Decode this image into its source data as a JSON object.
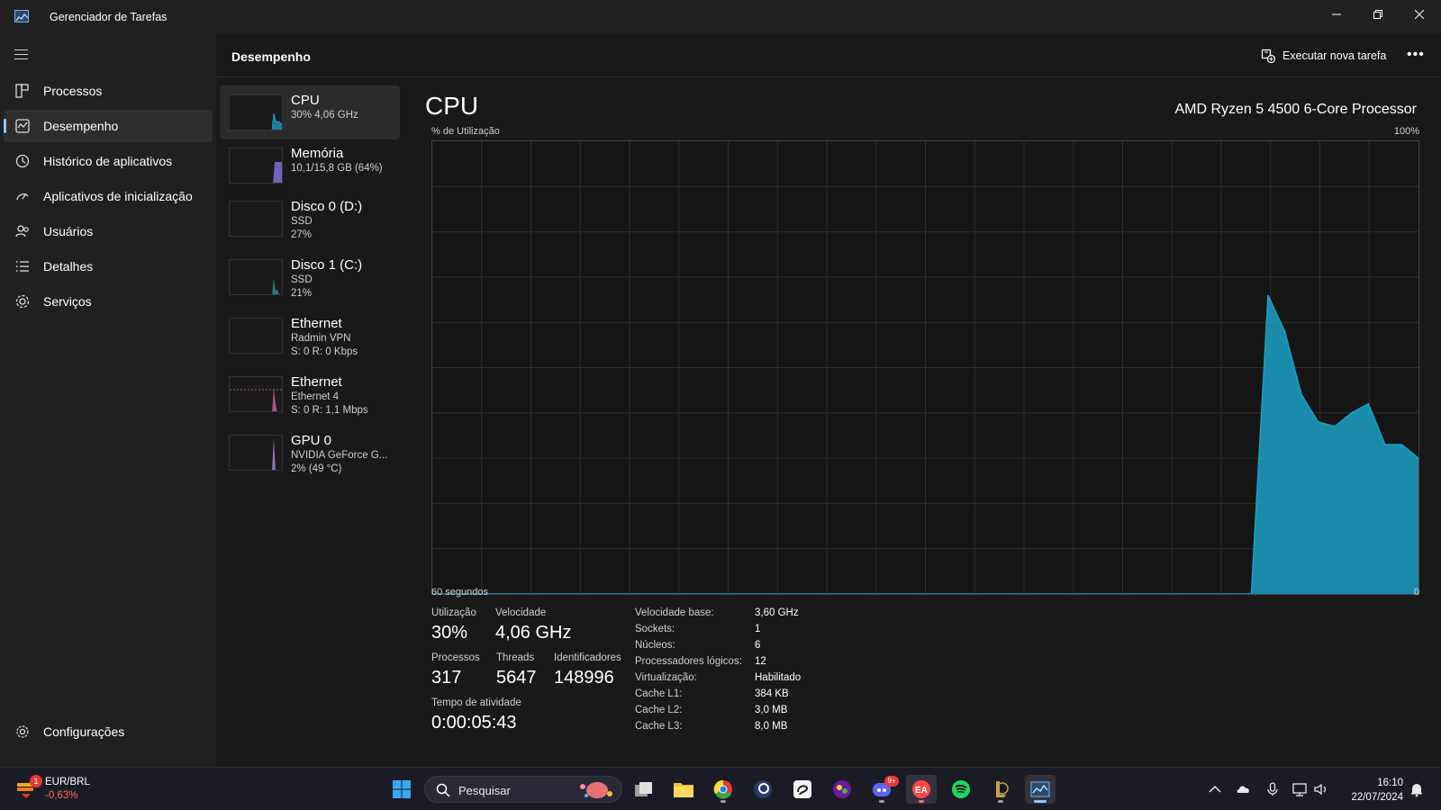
{
  "window": {
    "title": "Gerenciador de Tarefas",
    "minimize_icon": "minimize-icon",
    "restore_icon": "restore-icon",
    "close_icon": "close-icon"
  },
  "sidebar": {
    "items": [
      {
        "label": "Processos",
        "icon": "processes-icon"
      },
      {
        "label": "Desempenho",
        "icon": "performance-icon",
        "active": true
      },
      {
        "label": "Histórico de aplicativos",
        "icon": "history-icon"
      },
      {
        "label": "Aplicativos de inicialização",
        "icon": "startup-icon"
      },
      {
        "label": "Usuários",
        "icon": "users-icon"
      },
      {
        "label": "Detalhes",
        "icon": "details-icon"
      },
      {
        "label": "Serviços",
        "icon": "services-icon"
      }
    ],
    "settings_label": "Configurações"
  },
  "header": {
    "title": "Desempenho",
    "run_task_label": "Executar nova tarefa",
    "more_label": "•••"
  },
  "resources": [
    {
      "name": "CPU",
      "line1": "30% 4,06 GHz",
      "line2": "",
      "color": "#17a5c7"
    },
    {
      "name": "Memória",
      "line1": "10,1/15,8 GB (64%)",
      "line2": "",
      "color": "#8e7cf0"
    },
    {
      "name": "Disco 0 (D:)",
      "line1": "SSD",
      "line2": "27%",
      "color": "#2aa198"
    },
    {
      "name": "Disco 1 (C:)",
      "line1": "SSD",
      "line2": "21%",
      "color": "#2aa198"
    },
    {
      "name": "Ethernet",
      "line1": "Radmin VPN",
      "line2": "S: 0 R: 0 Kbps",
      "color": "#d45fa0"
    },
    {
      "name": "Ethernet",
      "line1": "Ethernet 4",
      "line2": "S: 0 R: 1,1 Mbps",
      "color": "#d45fa0"
    },
    {
      "name": "GPU 0",
      "line1": "NVIDIA GeForce G...",
      "line2": "2% (49 °C)",
      "color": "#a97de0"
    }
  ],
  "detail": {
    "title": "CPU",
    "model": "AMD Ryzen 5 4500 6-Core Processor",
    "y_label": "% de Utilização",
    "y_max": "100%",
    "x_label": "60 segundos",
    "y_min": "0",
    "fill_color": "#1ba0c4",
    "series": [
      0,
      0,
      0,
      0,
      0,
      0,
      0,
      0,
      0,
      0,
      0,
      0,
      0,
      0,
      0,
      0,
      0,
      0,
      0,
      0,
      0,
      0,
      0,
      0,
      0,
      0,
      0,
      0,
      0,
      0,
      0,
      0,
      0,
      0,
      0,
      0,
      0,
      0,
      0,
      0,
      0,
      0,
      0,
      0,
      0,
      0,
      0,
      0,
      0,
      0,
      66,
      58,
      44,
      38,
      37,
      40,
      42,
      33,
      33,
      30
    ],
    "stats": {
      "util_label": "Utilização",
      "util_value": "30%",
      "speed_label": "Velocidade",
      "speed_value": "4,06 GHz",
      "proc_label": "Processos",
      "proc_value": "317",
      "threads_label": "Threads",
      "threads_value": "5647",
      "handles_label": "Identificadores",
      "handles_value": "148996",
      "uptime_label": "Tempo de atividade",
      "uptime_value": "0:00:05:43"
    },
    "specs": [
      {
        "label": "Velocidade base:",
        "value": "3,60 GHz"
      },
      {
        "label": "Sockets:",
        "value": "1"
      },
      {
        "label": "Núcleos:",
        "value": "6"
      },
      {
        "label": "Processadores lógicos:",
        "value": "12"
      },
      {
        "label": "Virtualização:",
        "value": "Habilitado"
      },
      {
        "label": "Cache L1:",
        "value": "384 KB"
      },
      {
        "label": "Cache L2:",
        "value": "3,0 MB"
      },
      {
        "label": "Cache L3:",
        "value": "8,0 MB"
      }
    ]
  },
  "taskbar": {
    "widget_title": "EUR/BRL",
    "widget_value": "-0,63%",
    "widget_badge": "1",
    "search_placeholder": "Pesquisar",
    "discord_badge": "9+",
    "time": "16:10",
    "date": "22/07/2024"
  }
}
